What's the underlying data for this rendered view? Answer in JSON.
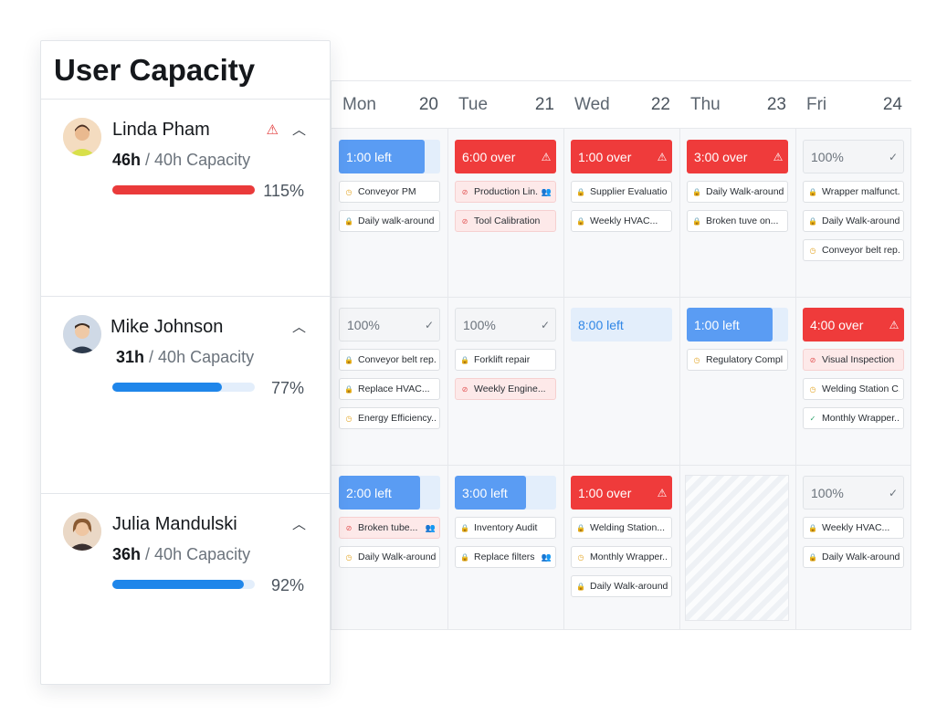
{
  "users_panel": {
    "title": "User Capacity",
    "capacity_suffix": "/ 40h Capacity",
    "users": [
      {
        "name": "Linda Pham",
        "hours": "46h",
        "percent": "115%",
        "progress": 1.0,
        "bar_color": "#ea3a3a",
        "warning": true,
        "avatar_bg": "#f6d9b8"
      },
      {
        "name": "Mike Johnson",
        "hours": "31h",
        "percent": "77%",
        "progress": 0.77,
        "bar_color": "#1f86ea",
        "warning": false,
        "avatar_bg": "#d6dde8"
      },
      {
        "name": "Julia Mandulski",
        "hours": "36h",
        "percent": "92%",
        "progress": 0.92,
        "bar_color": "#1f86ea",
        "warning": false,
        "avatar_bg": "#e8d4c3"
      }
    ]
  },
  "calendar": {
    "days": [
      {
        "name": "Mon",
        "num": "20"
      },
      {
        "name": "Tue",
        "num": "21"
      },
      {
        "name": "Wed",
        "num": "22"
      },
      {
        "name": "Thu",
        "num": "23"
      },
      {
        "name": "Fri",
        "num": "24"
      }
    ],
    "rows": [
      [
        {
          "cap": {
            "kind": "left",
            "label": "1:00 left",
            "fill": 0.85
          },
          "tasks": [
            {
              "label": "Conveyor PM",
              "icon": "clock",
              "red": false,
              "people": false
            },
            {
              "label": "Daily walk-around",
              "icon": "lock",
              "red": false,
              "people": false
            }
          ]
        },
        {
          "cap": {
            "kind": "over",
            "label": "6:00 over"
          },
          "tasks": [
            {
              "label": "Production Lin...",
              "icon": "warn",
              "red": true,
              "people": true
            },
            {
              "label": "Tool Calibration",
              "icon": "warn",
              "red": true,
              "people": false
            }
          ]
        },
        {
          "cap": {
            "kind": "over",
            "label": "1:00 over"
          },
          "tasks": [
            {
              "label": "Supplier Evaluation",
              "icon": "lock",
              "red": false,
              "people": false
            },
            {
              "label": "Weekly HVAC...",
              "icon": "lock",
              "red": false,
              "people": false
            }
          ]
        },
        {
          "cap": {
            "kind": "over",
            "label": "3:00 over"
          },
          "tasks": [
            {
              "label": "Daily Walk-around",
              "icon": "lock",
              "red": false,
              "people": false
            },
            {
              "label": "Broken tuve on...",
              "icon": "lock",
              "red": false,
              "people": false
            }
          ]
        },
        {
          "cap": {
            "kind": "full",
            "label": "100%"
          },
          "tasks": [
            {
              "label": "Wrapper malfunct...",
              "icon": "lock",
              "red": false,
              "people": false
            },
            {
              "label": "Daily Walk-around",
              "icon": "lock",
              "red": false,
              "people": false
            },
            {
              "label": "Conveyor belt rep...",
              "icon": "clock",
              "red": false,
              "people": false
            }
          ]
        }
      ],
      [
        {
          "cap": {
            "kind": "full",
            "label": "100%"
          },
          "tasks": [
            {
              "label": "Conveyor belt rep...",
              "icon": "lock",
              "red": false,
              "people": false
            },
            {
              "label": "Replace HVAC...",
              "icon": "lock",
              "red": false,
              "people": false
            },
            {
              "label": "Energy Efficiency...",
              "icon": "clock",
              "red": false,
              "people": false
            }
          ]
        },
        {
          "cap": {
            "kind": "full",
            "label": "100%"
          },
          "tasks": [
            {
              "label": "Forklift repair",
              "icon": "lock",
              "red": false,
              "people": false
            },
            {
              "label": "Weekly Engine...",
              "icon": "warn",
              "red": true,
              "people": false
            }
          ]
        },
        {
          "cap": {
            "kind": "left",
            "label": "8:00 left",
            "fill": 0.0
          },
          "tasks": []
        },
        {
          "cap": {
            "kind": "left",
            "label": "1:00 left",
            "fill": 0.85
          },
          "tasks": [
            {
              "label": "Regulatory Compl...",
              "icon": "clock",
              "red": false,
              "people": false
            }
          ]
        },
        {
          "cap": {
            "kind": "over",
            "label": "4:00 over"
          },
          "tasks": [
            {
              "label": "Visual Inspection",
              "icon": "warn",
              "red": true,
              "people": false
            },
            {
              "label": "Welding Station C...",
              "icon": "clock",
              "red": false,
              "people": false
            },
            {
              "label": "Monthly Wrapper...",
              "icon": "check",
              "red": false,
              "people": false
            }
          ]
        }
      ],
      [
        {
          "cap": {
            "kind": "left",
            "label": "2:00 left",
            "fill": 0.8
          },
          "tasks": [
            {
              "label": "Broken tube...",
              "icon": "warn",
              "red": true,
              "people": true
            },
            {
              "label": "Daily Walk-around",
              "icon": "clock",
              "red": false,
              "people": false
            }
          ]
        },
        {
          "cap": {
            "kind": "left",
            "label": "3:00 left",
            "fill": 0.7
          },
          "tasks": [
            {
              "label": "Inventory Audit",
              "icon": "lock",
              "red": false,
              "people": false
            },
            {
              "label": "Replace filters",
              "icon": "lock",
              "red": false,
              "people": true
            }
          ]
        },
        {
          "cap": {
            "kind": "over",
            "label": "1:00 over"
          },
          "tasks": [
            {
              "label": "Welding Station...",
              "icon": "lock",
              "red": false,
              "people": false
            },
            {
              "label": "Monthly Wrapper...",
              "icon": "clock",
              "red": false,
              "people": false
            },
            {
              "label": "Daily Walk-around",
              "icon": "lock",
              "red": false,
              "people": false
            }
          ]
        },
        {
          "cap": null,
          "tasks": []
        },
        {
          "cap": {
            "kind": "full",
            "label": "100%"
          },
          "tasks": [
            {
              "label": "Weekly HVAC...",
              "icon": "lock",
              "red": false,
              "people": false
            },
            {
              "label": "Daily Walk-around",
              "icon": "lock",
              "red": false,
              "people": false
            }
          ]
        }
      ]
    ]
  }
}
